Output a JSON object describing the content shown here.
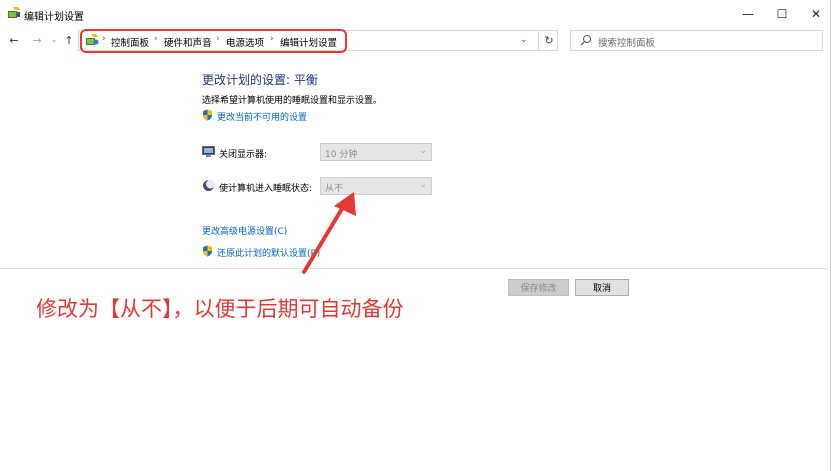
{
  "window": {
    "title": "编辑计划设置",
    "controls": {
      "minimize": "—",
      "maximize": "☐",
      "close": "✕"
    }
  },
  "toolbar": {
    "back": "←",
    "forward": "→",
    "recent": "⌄",
    "up": "↑",
    "dropdown": "⌄",
    "refresh": "↻"
  },
  "breadcrumb": {
    "separator": "›",
    "items": [
      "控制面板",
      "硬件和声音",
      "电源选项",
      "编辑计划设置"
    ]
  },
  "search": {
    "placeholder": "搜索控制面板"
  },
  "main": {
    "heading": "更改计划的设置: 平衡",
    "description": "选择希望计算机使用的睡眠设置和显示设置。",
    "change_unavailable_link": "更改当前不可用的设置",
    "settings": [
      {
        "label": "关闭显示器:",
        "value": "10 分钟",
        "icon": "monitor-icon"
      },
      {
        "label": "使计算机进入睡眠状态:",
        "value": "从不",
        "icon": "moon-icon"
      }
    ],
    "advanced_link": "更改高级电源设置(C)",
    "restore_link": "还原此计划的默认设置(R)"
  },
  "buttons": {
    "save": "保存修改",
    "cancel": "取消"
  },
  "annotation": {
    "text": "修改为【从不】，以便于后期可自动备份",
    "color": "#e53935"
  },
  "colors": {
    "heading": "#1e3287",
    "link": "#0066cc",
    "annotation": "#e53935"
  }
}
